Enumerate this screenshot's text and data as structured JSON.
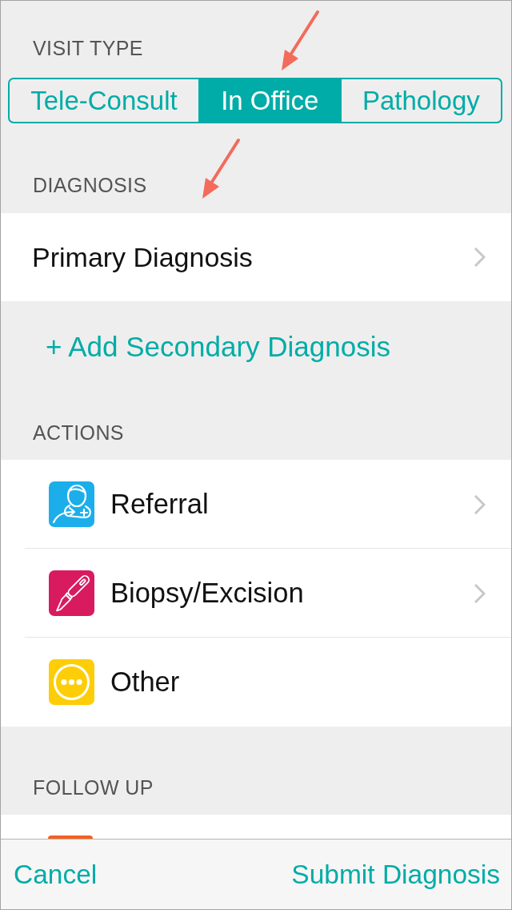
{
  "visit_type": {
    "header": "VISIT TYPE",
    "segments": [
      {
        "label": "Tele-Consult",
        "selected": false,
        "annotated": false
      },
      {
        "label": "In Office",
        "selected": true,
        "annotated": true
      },
      {
        "label": "Pathology",
        "selected": false,
        "annotated": false
      }
    ]
  },
  "diagnosis": {
    "header": "DIAGNOSIS",
    "rows": [
      {
        "label": "Primary Diagnosis",
        "disclosure": true,
        "annotated": true
      }
    ],
    "add_link": "+ Add Secondary Diagnosis"
  },
  "actions": {
    "header": "ACTIONS",
    "rows": [
      {
        "kind": "referral",
        "label": "Referral",
        "color": "#1caeea",
        "disclosure": true
      },
      {
        "kind": "biopsy",
        "label": "Biopsy/Excision",
        "color": "#d81b5e",
        "disclosure": true
      },
      {
        "kind": "other",
        "label": "Other",
        "color": "#fdcd07",
        "disclosure": false
      }
    ]
  },
  "follow_up": {
    "header": "FOLLOW UP",
    "rows": [
      {
        "color": "#f4601e"
      }
    ]
  },
  "toolbar": {
    "cancel": "Cancel",
    "submit": "Submit Diagnosis"
  }
}
